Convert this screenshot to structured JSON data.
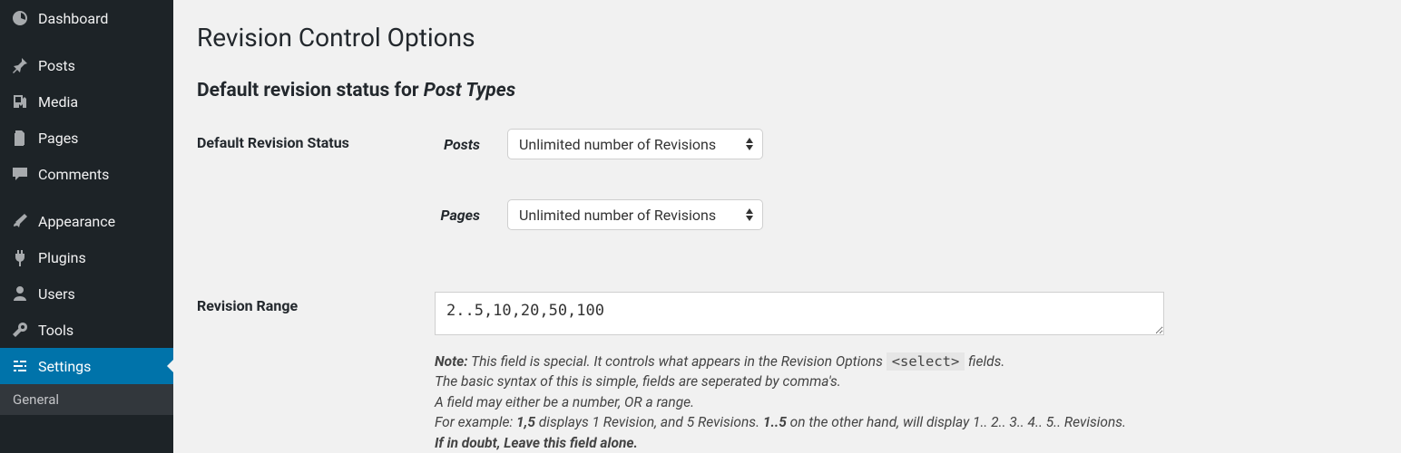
{
  "sidebar": {
    "items": [
      {
        "id": "dashboard",
        "label": "Dashboard",
        "icon": "dashboard-icon"
      },
      {
        "id": "posts",
        "label": "Posts",
        "icon": "pin-icon"
      },
      {
        "id": "media",
        "label": "Media",
        "icon": "media-icon"
      },
      {
        "id": "pages",
        "label": "Pages",
        "icon": "pages-icon"
      },
      {
        "id": "comments",
        "label": "Comments",
        "icon": "comment-icon"
      },
      {
        "id": "appearance",
        "label": "Appearance",
        "icon": "brush-icon"
      },
      {
        "id": "plugins",
        "label": "Plugins",
        "icon": "plug-icon"
      },
      {
        "id": "users",
        "label": "Users",
        "icon": "user-icon"
      },
      {
        "id": "tools",
        "label": "Tools",
        "icon": "wrench-icon"
      },
      {
        "id": "settings",
        "label": "Settings",
        "icon": "sliders-icon",
        "active": true
      }
    ],
    "submenu": [
      {
        "id": "general",
        "label": "General"
      }
    ]
  },
  "page": {
    "title": "Revision Control Options",
    "section_title_prefix": "Default revision status for ",
    "section_title_emph": "Post Types"
  },
  "form": {
    "default_status": {
      "label": "Default Revision Status",
      "rows": [
        {
          "label": "Posts",
          "selected": "Unlimited number of Revisions"
        },
        {
          "label": "Pages",
          "selected": "Unlimited number of Revisions"
        }
      ]
    },
    "revision_range": {
      "label": "Revision Range",
      "value": "2..5,10,20,50,100"
    }
  },
  "note": {
    "l1a": "Note:",
    "l1b": " This field is special. It controls what appears in the Revision Options ",
    "l1code": "<select>",
    "l1c": " fields.",
    "l2": "The basic syntax of this is simple, fields are seperated by comma's.",
    "l3": "A field may either be a number, OR a range.",
    "l4a": "For example: ",
    "l4b": "1,5",
    "l4c": " displays 1 Revision, and 5 Revisions. ",
    "l4d": "1..5",
    "l4e": " on the other hand, will display 1.. 2.. 3.. 4.. 5.. Revisions.",
    "l5": "If in doubt, Leave this field alone."
  }
}
